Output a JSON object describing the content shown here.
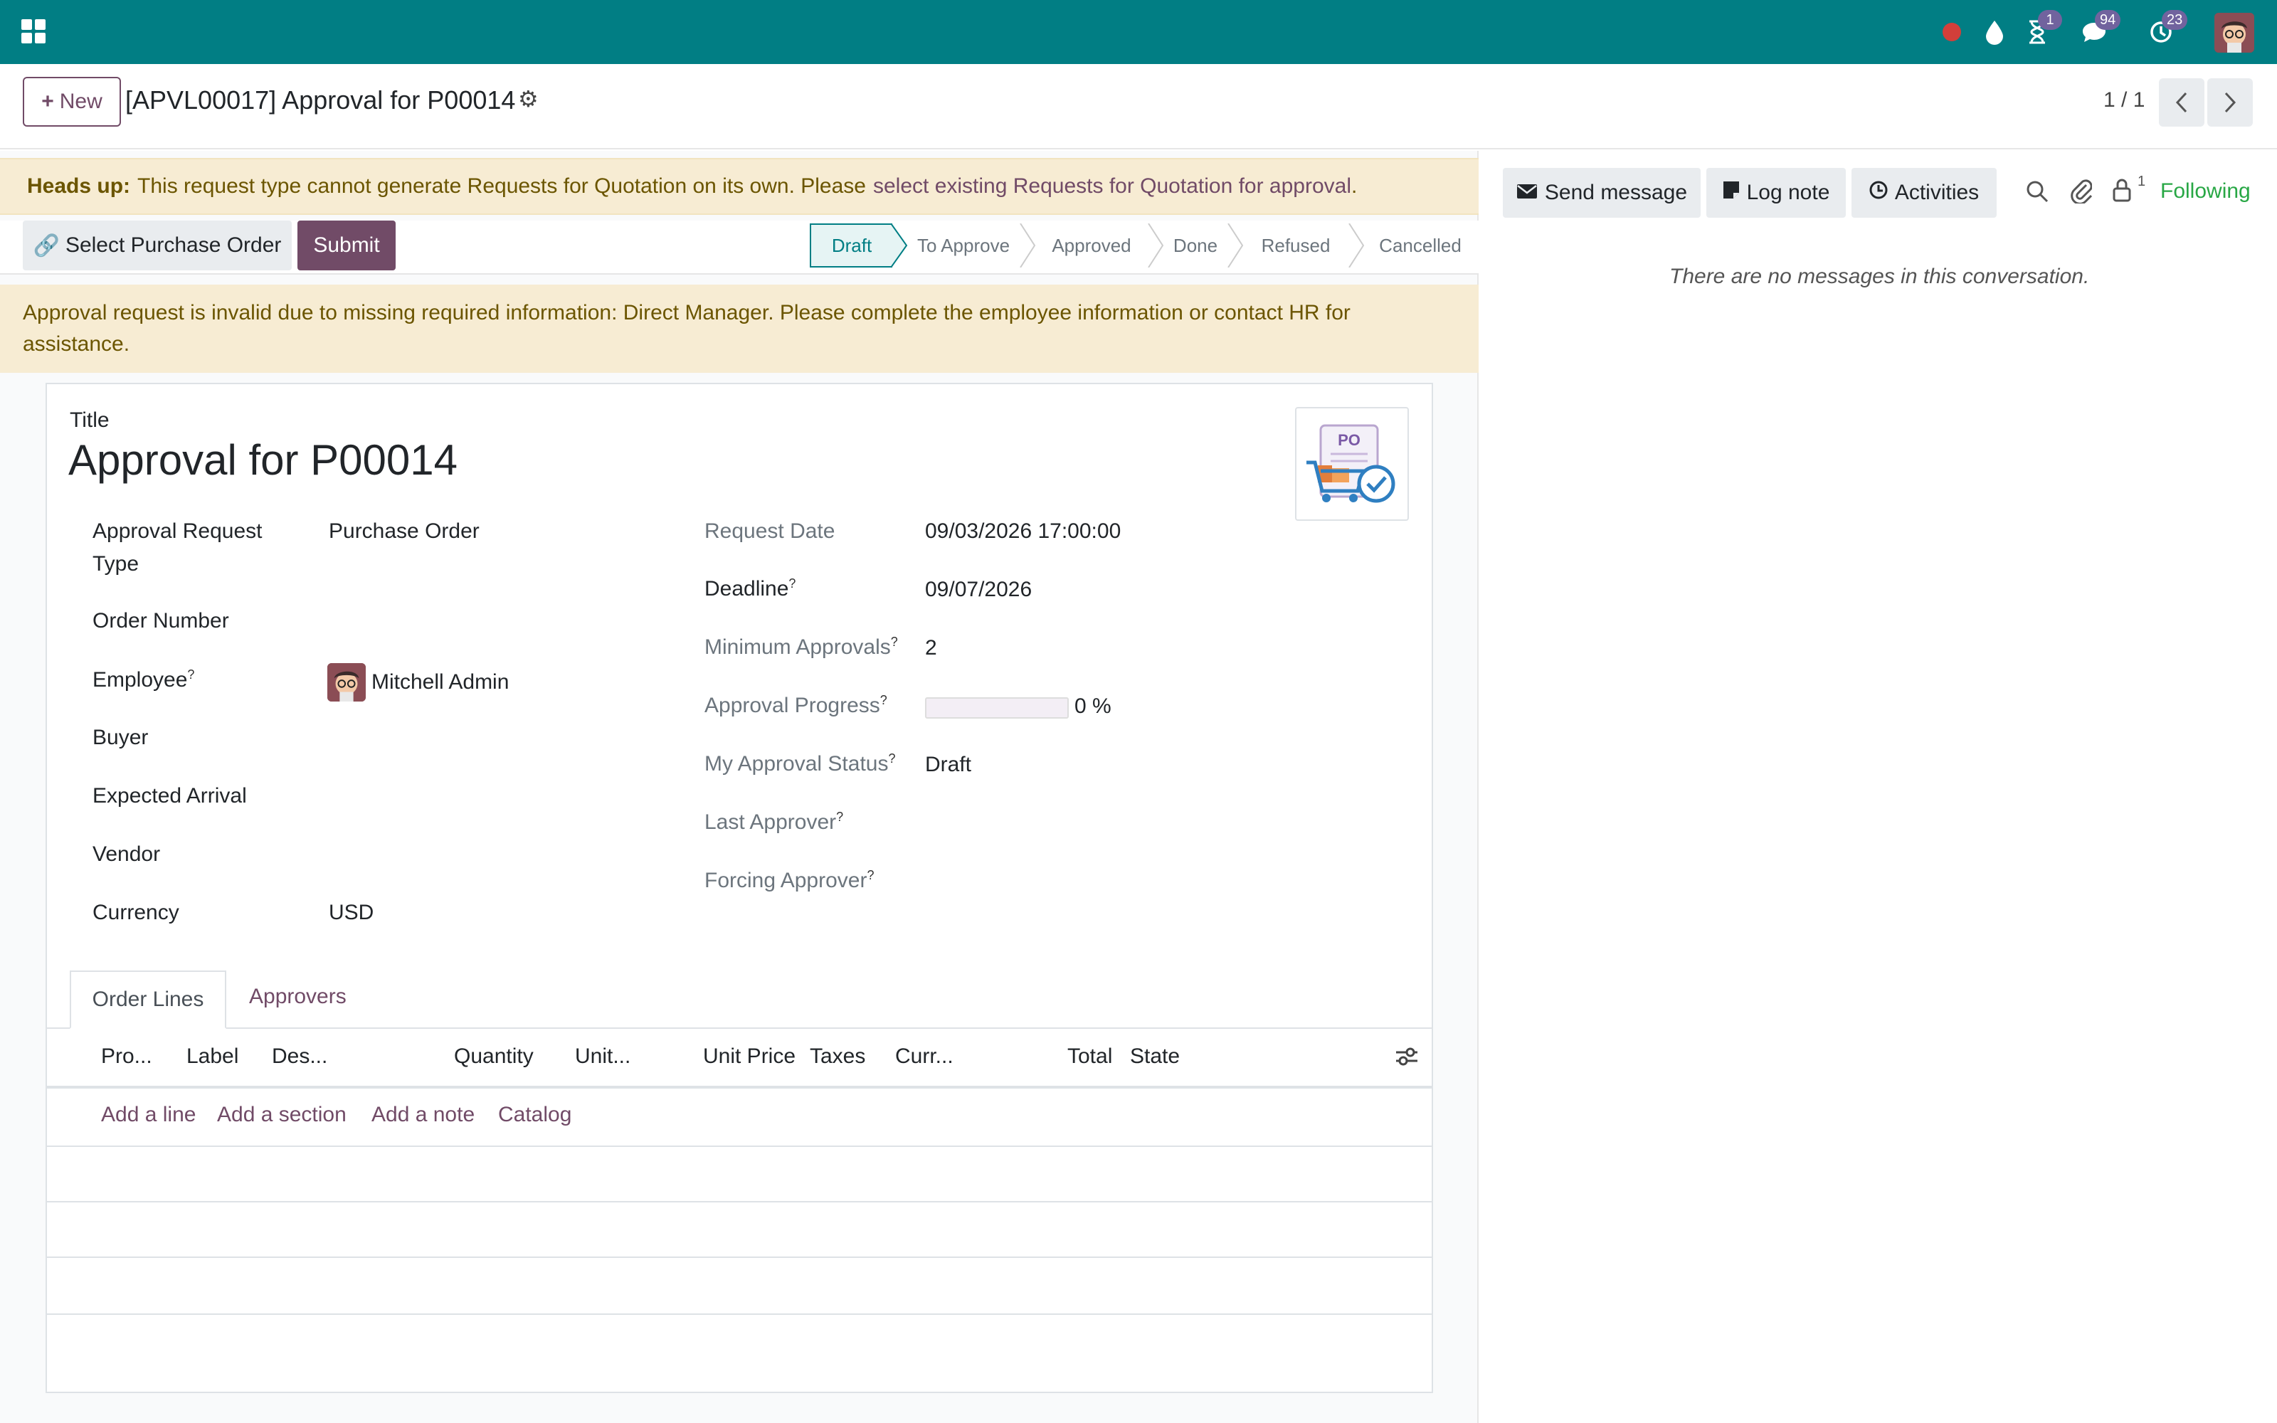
{
  "navbar": {
    "badges": {
      "activities": "1",
      "messages": "94",
      "updates": "23"
    }
  },
  "control": {
    "new_label": "New",
    "record_title": "[APVL00017] Approval for P00014",
    "pager": "1 / 1"
  },
  "alert_heads_up": {
    "strong": "Heads up:",
    "text": "This request type cannot generate Requests for Quotation on its own. Please",
    "link": "select existing Requests for Quotation for approval",
    "end": "."
  },
  "actions": {
    "select_po": "Select Purchase Order",
    "submit": "Submit"
  },
  "stages": [
    "Draft",
    "To Approve",
    "Approved",
    "Done",
    "Refused",
    "Cancelled"
  ],
  "alert_invalid": {
    "line1": "Approval request is invalid due to missing required information: Direct Manager. Please complete the employee information or contact HR for",
    "line2": "assistance."
  },
  "form": {
    "title_label": "Title",
    "title": "Approval for P00014",
    "left": {
      "type_label_1": "Approval Request",
      "type_label_2": "Type",
      "type_value": "Purchase Order",
      "order_number_label": "Order Number",
      "employee_label": "Employee",
      "employee_value": "Mitchell Admin",
      "buyer_label": "Buyer",
      "expected_arrival_label": "Expected Arrival",
      "vendor_label": "Vendor",
      "currency_label": "Currency",
      "currency_value": "USD"
    },
    "right": {
      "request_date_label": "Request Date",
      "request_date_value": "09/03/2026 17:00:00",
      "deadline_label": "Deadline",
      "deadline_value": "09/07/2026",
      "min_approvals_label": "Minimum Approvals",
      "min_approvals_value": "2",
      "progress_label": "Approval Progress",
      "progress_value": "0 %",
      "progress_fraction": 0,
      "my_status_label": "My Approval Status",
      "my_status_value": "Draft",
      "last_approver_label": "Last Approver",
      "forcing_approver_label": "Forcing Approver"
    },
    "help_mark": "?",
    "image_text": "PO"
  },
  "tabs": {
    "order_lines": "Order Lines",
    "approvers": "Approvers"
  },
  "table": {
    "headers": [
      "Pro...",
      "Label",
      "Des...",
      "Quantity",
      "Unit...",
      "Unit Price",
      "Taxes",
      "Curr...",
      "Total",
      "State"
    ]
  },
  "table_actions": [
    "Add a line",
    "Add a section",
    "Add a note",
    "Catalog"
  ],
  "chatter": {
    "send_message": "Send message",
    "log_note": "Log note",
    "activities": "Activities",
    "followers_count": "1",
    "following": "Following",
    "no_messages": "There are no messages in this conversation."
  }
}
